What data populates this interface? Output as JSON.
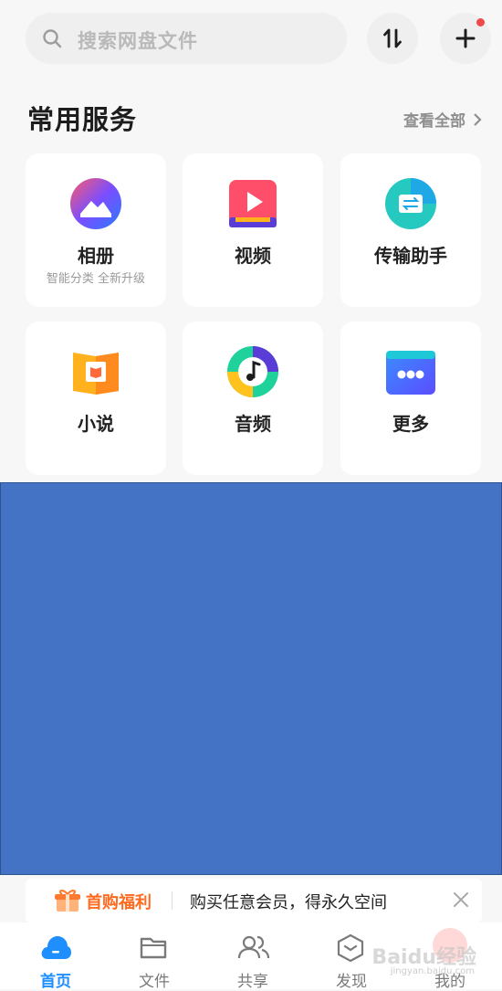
{
  "search": {
    "placeholder": "搜索网盘文件"
  },
  "services": {
    "title": "常用服务",
    "view_all": "查看全部",
    "items": [
      {
        "label": "相册",
        "sub": "智能分类 全新升级",
        "icon": "photo-album-icon"
      },
      {
        "label": "视频",
        "sub": "",
        "icon": "video-icon"
      },
      {
        "label": "传输助手",
        "sub": "",
        "icon": "transfer-assistant-icon"
      },
      {
        "label": "小说",
        "sub": "",
        "icon": "novel-icon"
      },
      {
        "label": "音频",
        "sub": "",
        "icon": "audio-icon"
      },
      {
        "label": "更多",
        "sub": "",
        "icon": "more-icon"
      }
    ]
  },
  "promo": {
    "tag": "首购福利",
    "text": "购买任意会员，得永久空间"
  },
  "tabs": [
    {
      "label": "首页",
      "icon": "cloud-home-icon",
      "active": true
    },
    {
      "label": "文件",
      "icon": "folder-icon",
      "active": false
    },
    {
      "label": "共享",
      "icon": "share-people-icon",
      "active": false
    },
    {
      "label": "发现",
      "icon": "discover-icon",
      "active": false
    },
    {
      "label": "我的",
      "icon": "avatar-icon",
      "active": false
    }
  ],
  "watermark": {
    "brand": "Baidu经验",
    "url": "jingyan.baidu.com"
  },
  "colors": {
    "accent": "#1f8fff",
    "promo": "#ff6a1f",
    "overlay": "#4472c4",
    "badge": "#ee4a4a"
  }
}
